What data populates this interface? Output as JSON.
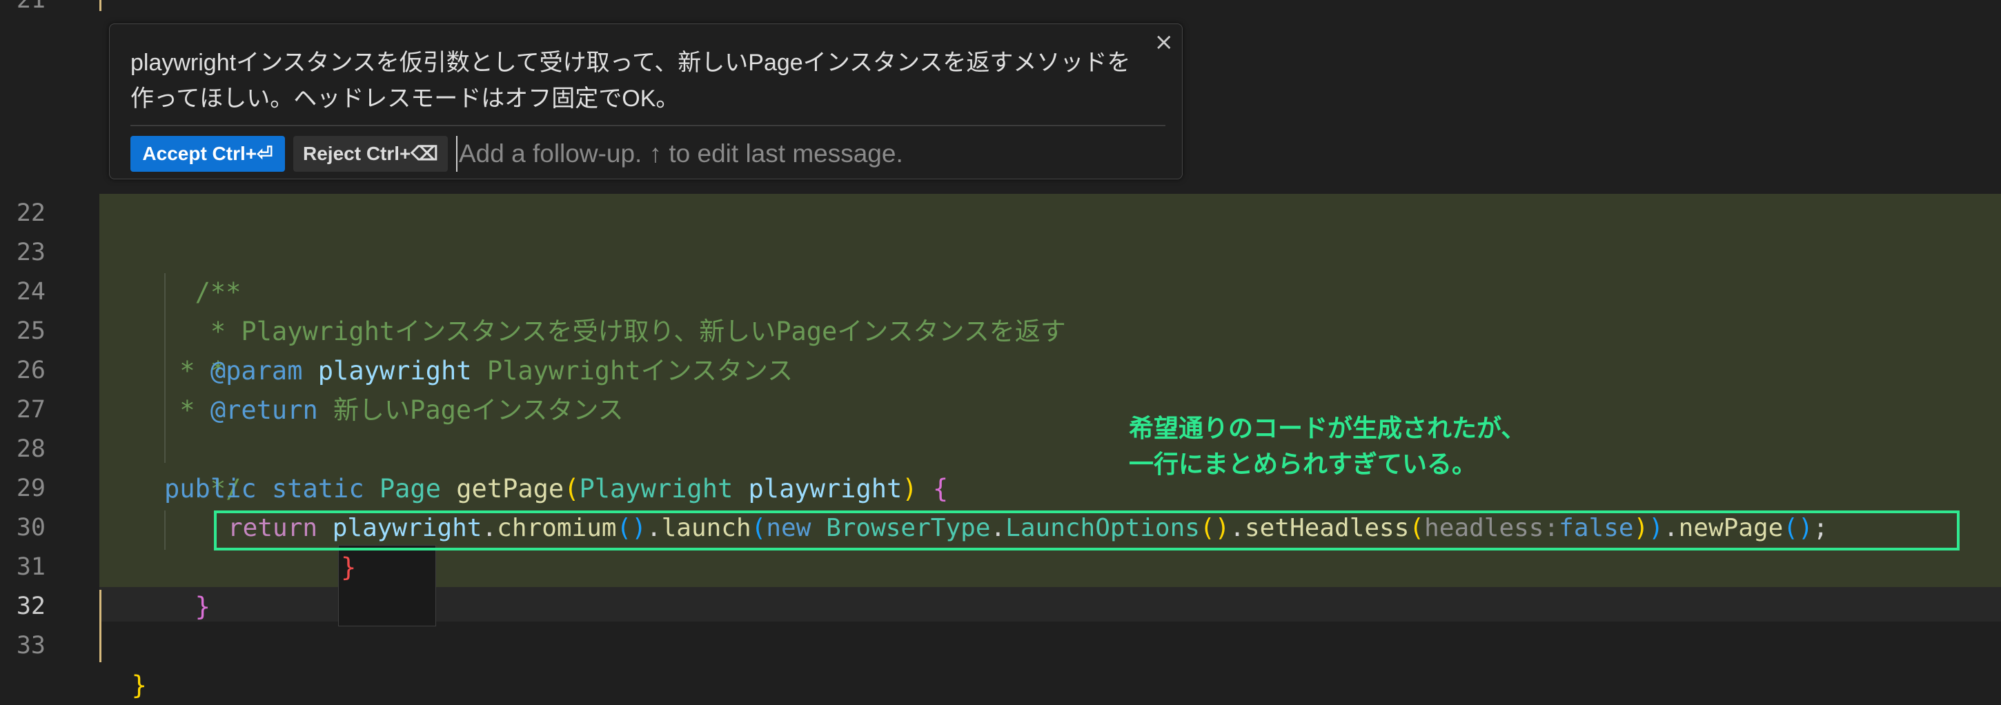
{
  "editor": {
    "line_numbers": [
      "21",
      "22",
      "23",
      "24",
      "25",
      "26",
      "27",
      "28",
      "29",
      "30",
      "31",
      "32",
      "33"
    ],
    "top_brace": "}",
    "comment_open": "/**",
    "doc_line_24": " * Playwrightインスタンスを受け取り、新しいPageインスタンスを返す",
    "doc_line_25": " *",
    "doc_star": " * ",
    "param_tag": "@param",
    "param_name": "playwright",
    "param_desc": "Playwrightインスタンス",
    "return_tag": "@return",
    "return_desc": "新しいPageインスタンス",
    "comment_close": " */",
    "kw_public": "public",
    "kw_static": "static",
    "type_page": "Page",
    "method_name": "getPage",
    "type_playwright": "Playwright",
    "param_var": "playwright",
    "kw_return": "return",
    "var_playwright": "playwright",
    "fn_chromium": "chromium",
    "fn_launch": "launch",
    "kw_new": "new",
    "type_browsertype": "BrowserType",
    "type_launchoptions": "LaunchOptions",
    "fn_setheadless": "setHeadless",
    "hint_headless": "headless:",
    "kw_false": "false",
    "fn_newpage": "newPage",
    "close_brace_31": "}",
    "ghost_brace": "}",
    "close_brace_33": "}"
  },
  "inline_chat": {
    "message": "playwrightインスタンスを仮引数として受け取って、新しいPageインスタンスを返すメソッドを作ってほしい。ヘッドレスモードはオフ固定でOK。",
    "close_label": "×",
    "accept_label": "Accept Ctrl+⏎",
    "reject_label": "Reject Ctrl+⌫",
    "followup_placeholder": "Add a follow-up. ↑ to edit last message."
  },
  "annotation": {
    "line1": "希望通りのコードが生成されたが、",
    "line2": "一行にまとめられすぎている。"
  },
  "colors": {
    "accent_button": "#0e72d4",
    "annotation_green": "#2ee890",
    "diff_highlight": "#373d29"
  }
}
